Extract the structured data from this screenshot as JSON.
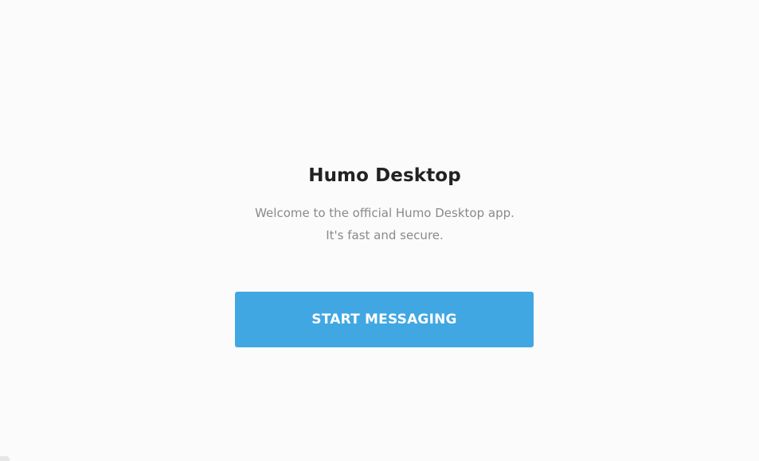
{
  "app": {
    "title": "Humo Desktop"
  },
  "welcome": {
    "description_line1": "Welcome to the official Humo Desktop app.",
    "description_line2": "It's fast and secure.",
    "start_button_label": "START MESSAGING"
  },
  "colors": {
    "background": "#fbfbfb",
    "accent": "#40a7e3",
    "title_text": "#222222",
    "secondary_text": "#8a8a8a"
  }
}
